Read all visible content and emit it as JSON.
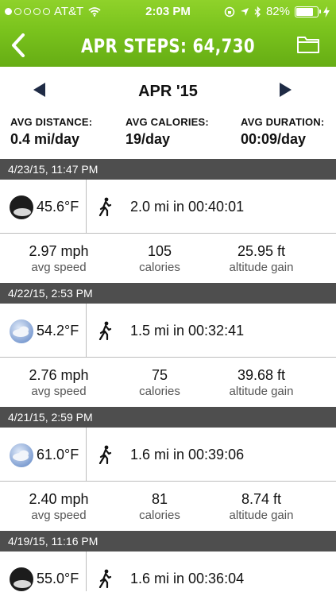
{
  "status_bar": {
    "carrier": "AT&T",
    "time": "2:03 PM",
    "battery": "82%",
    "battery_level": 0.82
  },
  "nav": {
    "title": "APR STEPS: 64,730",
    "back_icon": "chevron-left-icon",
    "folder_icon": "folder-icon"
  },
  "month": {
    "label": "APR '15"
  },
  "averages": {
    "distance_label": "AVG DISTANCE:",
    "distance_value": "0.4 mi/day",
    "calories_label": "AVG CALORIES:",
    "calories_value": "19/day",
    "duration_label": "AVG DURATION:",
    "duration_value": "00:09/day"
  },
  "activities": [
    {
      "date": "4/23/15, 11:47 PM",
      "weather": "moon-icon",
      "temp": "45.6°F",
      "summary": "2.0 mi in 00:40:01",
      "speed": "2.97 mph",
      "speed_label": "avg speed",
      "calories": "105",
      "calories_label": "calories",
      "altitude": "25.95 ft",
      "altitude_label": "altitude gain"
    },
    {
      "date": "4/22/15, 2:53 PM",
      "weather": "cloud-icon",
      "temp": "54.2°F",
      "summary": "1.5 mi in 00:32:41",
      "speed": "2.76 mph",
      "speed_label": "avg speed",
      "calories": "75",
      "calories_label": "calories",
      "altitude": "39.68 ft",
      "altitude_label": "altitude gain"
    },
    {
      "date": "4/21/15, 2:59 PM",
      "weather": "cloud-icon",
      "temp": "61.0°F",
      "summary": "1.6 mi in 00:39:06",
      "speed": "2.40 mph",
      "speed_label": "avg speed",
      "calories": "81",
      "calories_label": "calories",
      "altitude": "8.74 ft",
      "altitude_label": "altitude gain"
    },
    {
      "date": "4/19/15, 11:16 PM",
      "weather": "moon-icon",
      "temp": "55.0°F",
      "summary": "1.6 mi in 00:36:04"
    }
  ]
}
